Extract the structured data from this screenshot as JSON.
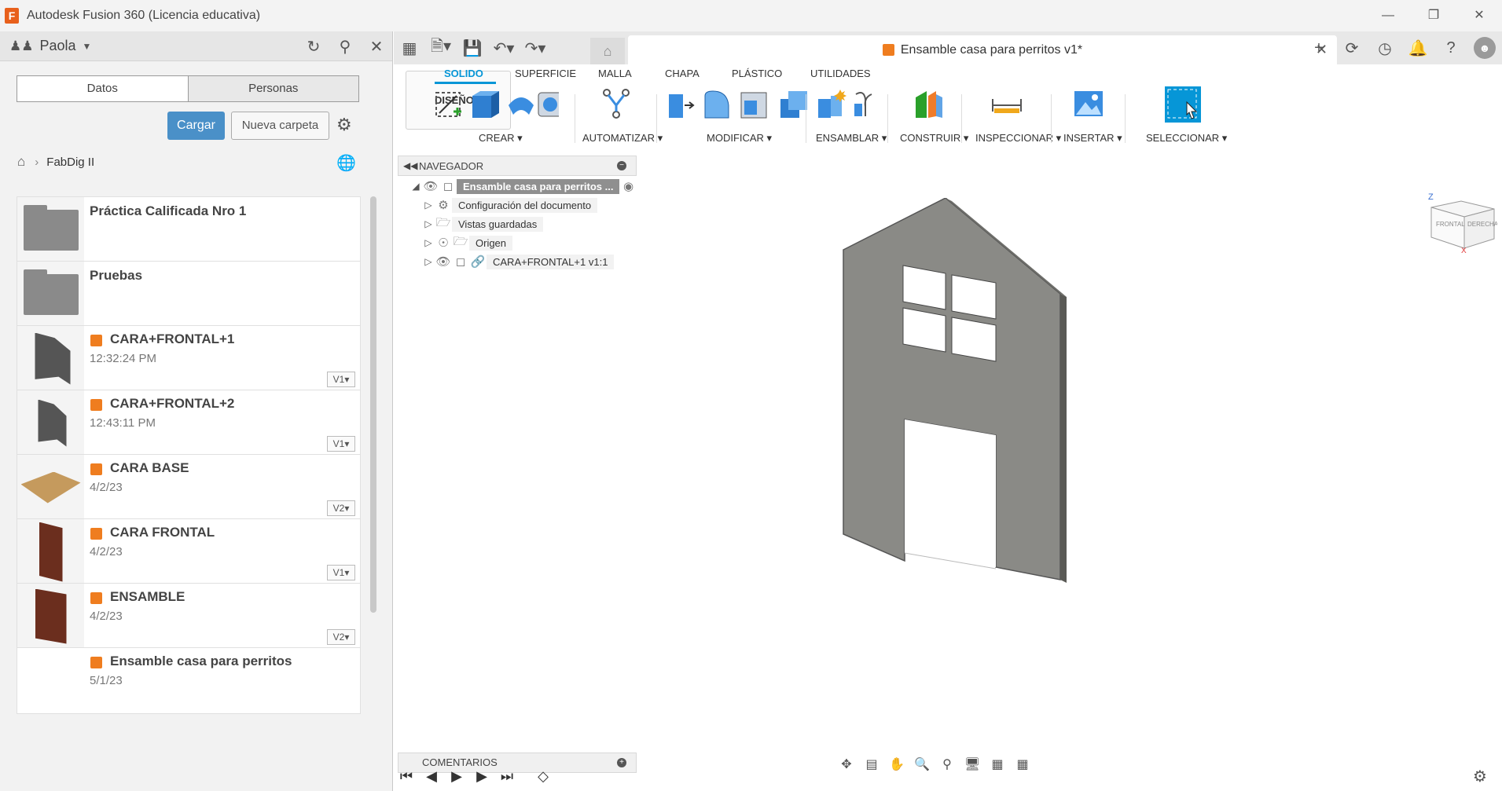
{
  "window": {
    "title": "Autodesk Fusion 360 (Licencia educativa)",
    "logo_letter": "F",
    "controls": [
      "—",
      "❐",
      "✕"
    ]
  },
  "data_panel": {
    "user": "Paola",
    "tabs": [
      {
        "label": "Datos"
      },
      {
        "label": "Personas"
      }
    ],
    "upload_label": "Cargar",
    "new_folder_label": "Nueva carpeta",
    "breadcrumb": {
      "project": "FabDig II"
    },
    "folders": [
      {
        "name": "Práctica Calificada Nro 1"
      },
      {
        "name": "Pruebas"
      }
    ],
    "files": [
      {
        "name": "CARA+FRONTAL+1",
        "date": "12:32:24 PM",
        "version": "V1▾"
      },
      {
        "name": "CARA+FRONTAL+2",
        "date": "12:43:11 PM",
        "version": "V1▾"
      },
      {
        "name": "CARA BASE",
        "date": "4/2/23",
        "version": "V2▾"
      },
      {
        "name": "CARA FRONTAL",
        "date": "4/2/23",
        "version": "V1▾"
      },
      {
        "name": "ENSAMBLE",
        "date": "4/2/23",
        "version": "V2▾"
      },
      {
        "name": "Ensamble casa para perritos",
        "date": "5/1/23",
        "version": ""
      }
    ]
  },
  "document": {
    "tab_title": "Ensamble casa para perritos v1*"
  },
  "ribbon": {
    "workspace": "DISEÑO ▾",
    "tabs": [
      "SOLIDO",
      "SUPERFICIE",
      "MALLA",
      "CHAPA",
      "PLÁSTICO",
      "UTILIDADES"
    ],
    "active_tab": "SOLIDO",
    "groups": [
      "CREAR ▾",
      "AUTOMATIZAR ▾",
      "MODIFICAR ▾",
      "ENSAMBLAR ▾",
      "CONSTRUIR ▾",
      "INSPECCIONAR ▾",
      "INSERTAR ▾",
      "SELECCIONAR ▾"
    ]
  },
  "browser": {
    "title": "NAVEGADOR",
    "root": "Ensamble casa para perritos ...",
    "items": [
      {
        "label": "Configuración del documento",
        "icon": "gear-icon"
      },
      {
        "label": "Vistas guardadas",
        "icon": "folder-icon"
      },
      {
        "label": "Origen",
        "icon": "folder-icon"
      },
      {
        "label": "CARA+FRONTAL+1 v1:1",
        "icon": "link-icon"
      }
    ]
  },
  "viewcube": {
    "front": "FRONTAL",
    "right": "DERECHA",
    "axis_z": "Z",
    "axis_x": "X"
  },
  "comments": {
    "title": "COMENTARIOS"
  },
  "colors": {
    "accent": "#0696d7",
    "upload_button": "#4a90c8",
    "part_gray": "#8a8a86",
    "cube_orange": "#ef7d1f"
  }
}
